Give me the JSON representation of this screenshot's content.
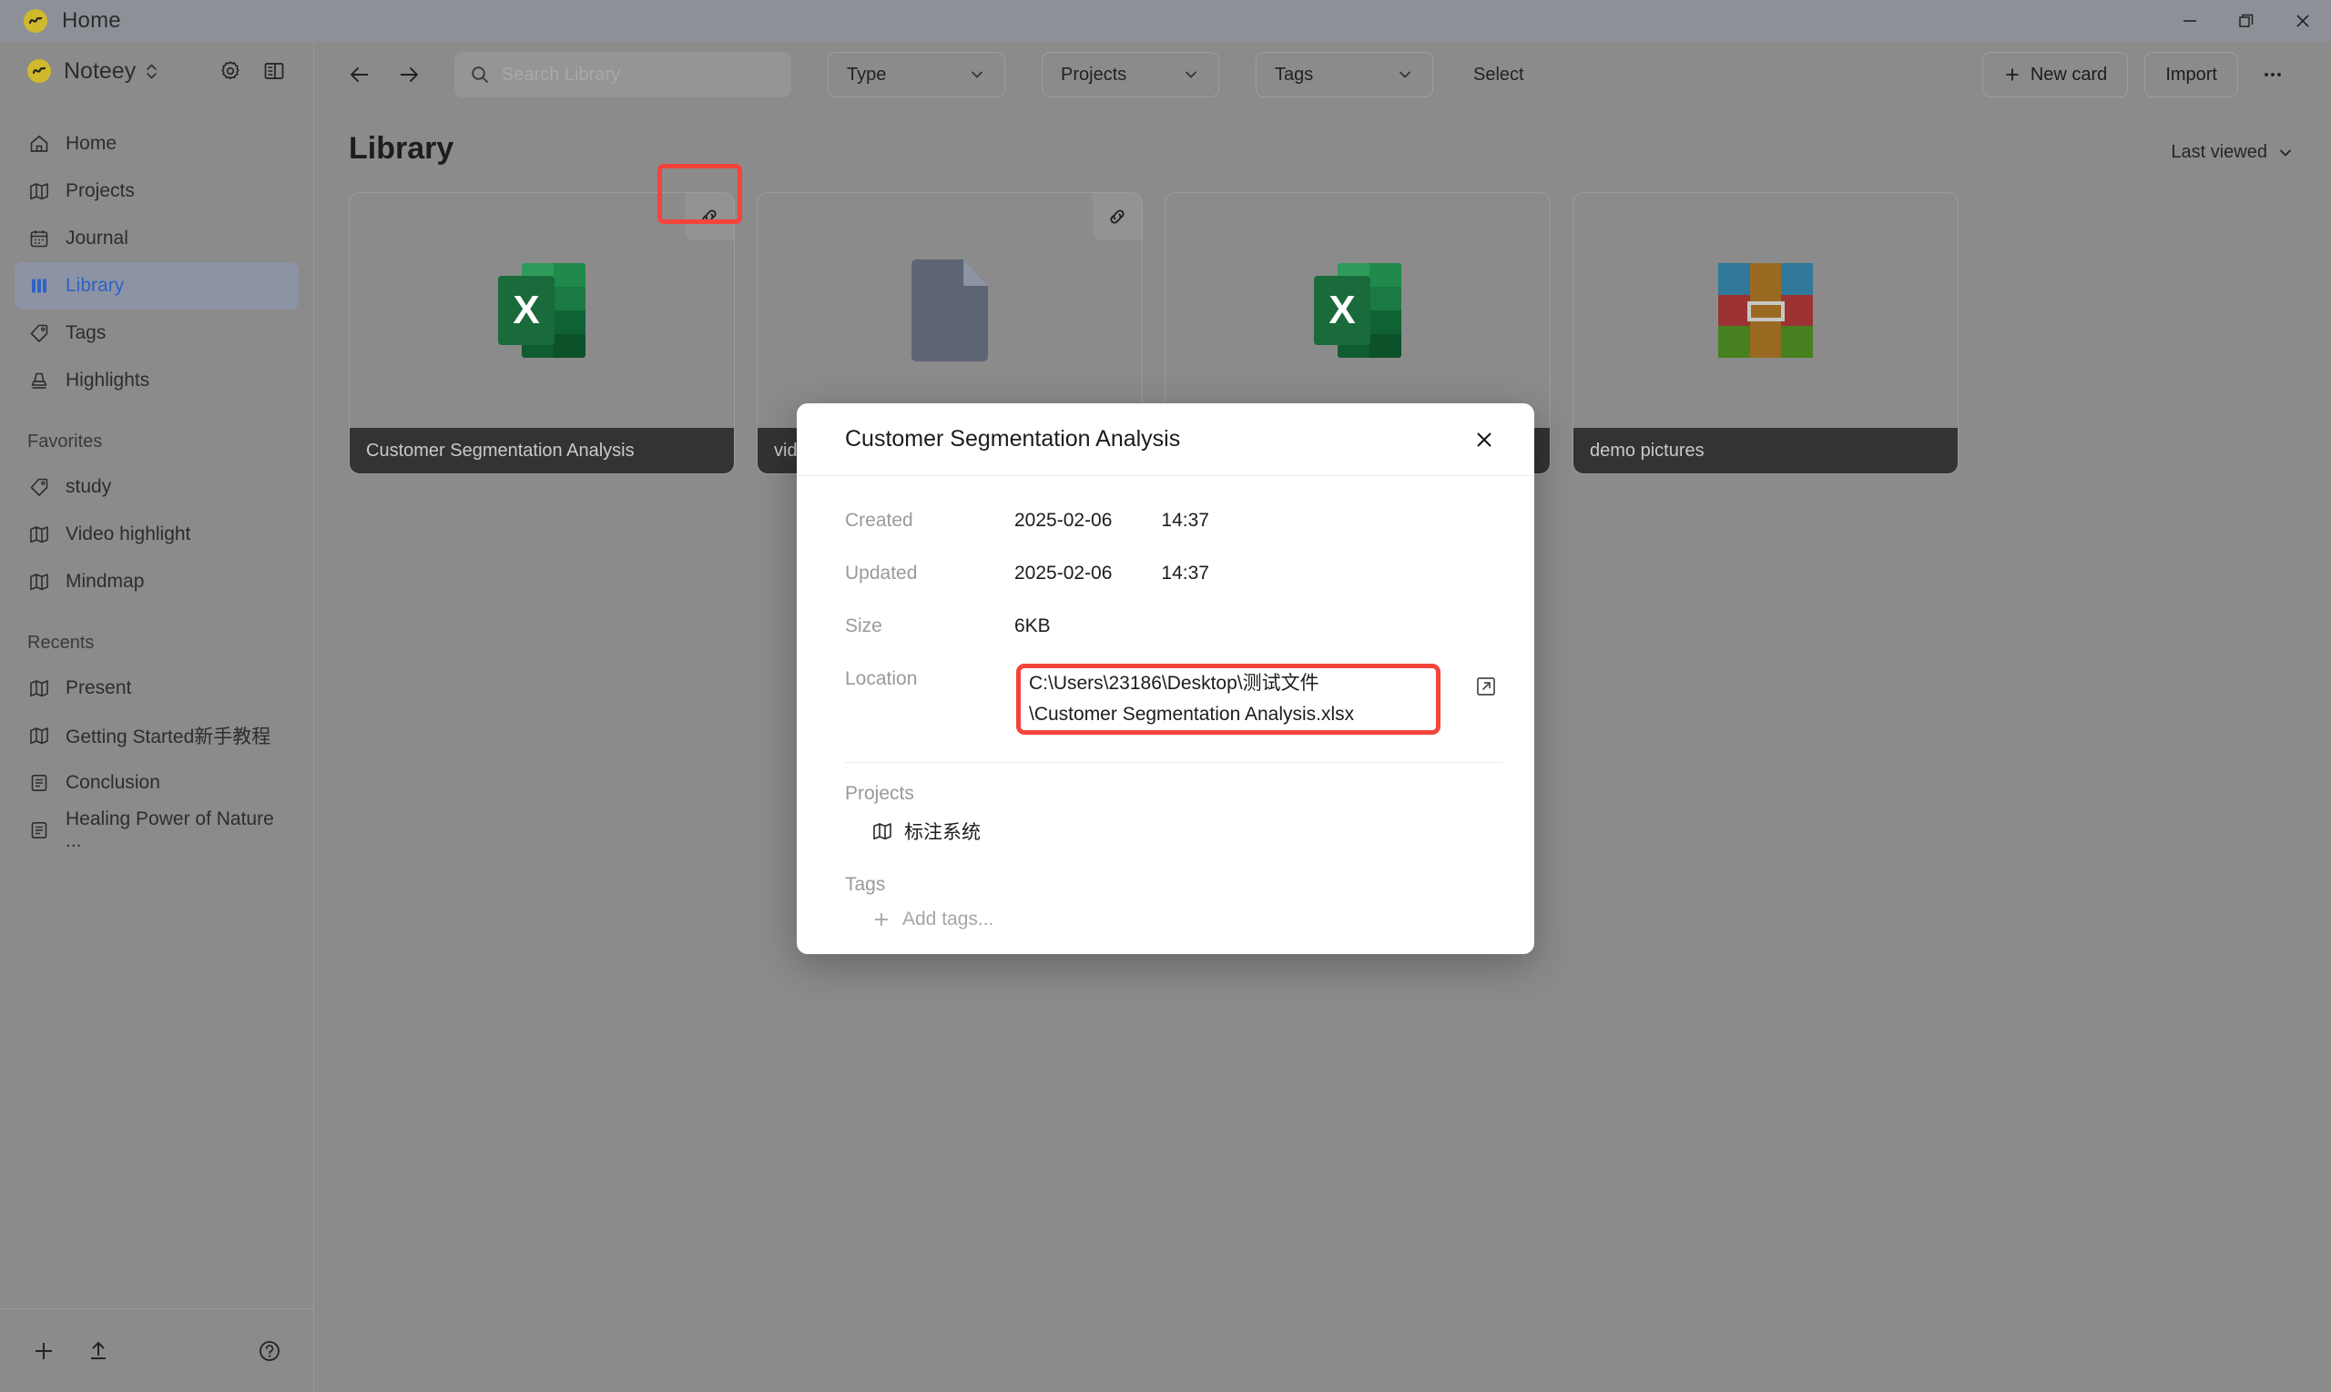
{
  "titlebar": {
    "title": "Home",
    "logo_color": "#cfb92c",
    "controls": [
      {
        "name": "minimize",
        "glyph": "minimize-icon"
      },
      {
        "name": "maximize",
        "glyph": "restore-icon"
      },
      {
        "name": "close",
        "glyph": "close-icon"
      }
    ]
  },
  "sidebar": {
    "workspace": "Noteey",
    "nav": [
      {
        "label": "Home",
        "icon": "home-icon",
        "active": false
      },
      {
        "label": "Projects",
        "icon": "map-icon",
        "active": false
      },
      {
        "label": "Journal",
        "icon": "calendar-icon",
        "active": false
      },
      {
        "label": "Library",
        "icon": "library-icon",
        "active": true
      },
      {
        "label": "Tags",
        "icon": "tag-icon",
        "active": false
      },
      {
        "label": "Highlights",
        "icon": "highlight-icon",
        "active": false
      }
    ],
    "favorites_heading": "Favorites",
    "favorites": [
      {
        "label": "study",
        "icon": "tag-icon"
      },
      {
        "label": "Video highlight",
        "icon": "map-icon"
      },
      {
        "label": "Mindmap",
        "icon": "map-icon"
      }
    ],
    "recents_heading": "Recents",
    "recents": [
      {
        "label": "Present",
        "icon": "map-icon"
      },
      {
        "label": "Getting Started新手教程",
        "icon": "map-icon"
      },
      {
        "label": "Conclusion",
        "icon": "doc-icon"
      },
      {
        "label": "Healing Power of Nature ...",
        "icon": "doc-icon"
      }
    ],
    "footer": [
      {
        "name": "add",
        "icon": "plus-icon"
      },
      {
        "name": "upload",
        "icon": "upload-icon"
      },
      {
        "name": "help",
        "icon": "help-icon"
      }
    ],
    "active_color": "#2f62c4"
  },
  "toolbar": {
    "back": "back-arrow-icon",
    "forward": "forward-arrow-icon",
    "search_placeholder": "Search Library",
    "search_value": "",
    "filters": [
      {
        "label": "Type"
      },
      {
        "label": "Projects"
      },
      {
        "label": "Tags"
      }
    ],
    "select_label": "Select",
    "new_card_label": "New card",
    "import_label": "Import",
    "more_label": "•••"
  },
  "page": {
    "title": "Library",
    "sort_label": "Last viewed"
  },
  "cards": [
    {
      "caption": "Customer Segmentation Analysis",
      "thumb": "excel-icon",
      "has_link_badge": true
    },
    {
      "caption": "vide",
      "thumb": "document-icon",
      "has_link_badge": true
    },
    {
      "caption": "",
      "thumb": "excel-icon",
      "has_link_badge": false
    },
    {
      "caption": "demo pictures",
      "thumb": "picture-grid-icon",
      "has_link_badge": false
    }
  ],
  "modal": {
    "title": "Customer Segmentation Analysis",
    "close_icon": "close-icon",
    "created_label": "Created",
    "created_date": "2025-02-06",
    "created_time": "14:37",
    "updated_label": "Updated",
    "updated_date": "2025-02-06",
    "updated_time": "14:37",
    "size_label": "Size",
    "size_value": "6KB",
    "location_label": "Location",
    "location_path": "C:\\Users\\23186\\Desktop\\测试文件\\Customer Segmentation Analysis.xlsx",
    "open_location_icon": "external-link-icon",
    "projects_label": "Projects",
    "project_chip": "标注系统",
    "tags_label": "Tags",
    "add_tags_label": "Add tags..."
  },
  "annotations": {
    "highlight_color": "#f4433b",
    "items": [
      {
        "name": "link-badge-highlight",
        "target": "card-link-badge"
      },
      {
        "name": "location-path-highlight",
        "target": "modal-location-path"
      }
    ]
  }
}
